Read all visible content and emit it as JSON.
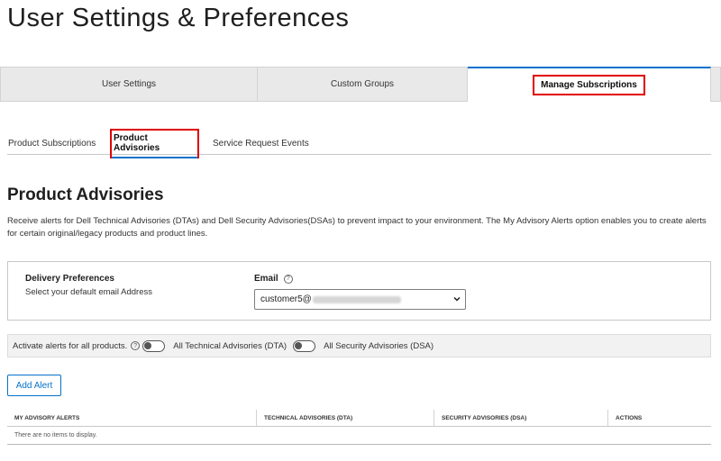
{
  "page_title": "User Settings & Preferences",
  "main_tabs": [
    {
      "label": "User Settings"
    },
    {
      "label": "Custom Groups"
    },
    {
      "label": "Manage Subscriptions"
    }
  ],
  "sub_tabs": [
    {
      "label": "Product Subscriptions"
    },
    {
      "label": "Product Advisories"
    },
    {
      "label": "Service Request Events"
    }
  ],
  "section": {
    "heading": "Product Advisories",
    "description": "Receive alerts for Dell Technical Advisories (DTAs) and Dell Security Advisories(DSAs) to prevent impact to your environment. The My Advisory Alerts option enables you to create alerts for certain original/legacy products and product lines."
  },
  "delivery": {
    "title": "Delivery Preferences",
    "subtitle": "Select your default email Address",
    "email_label": "Email",
    "email_value": "customer5@"
  },
  "alerts_bar": {
    "activate_label": "Activate alerts for all products.",
    "dta_label": "All Technical Advisories (DTA)",
    "dsa_label": "All Security Advisories (DSA)"
  },
  "add_alert_label": "Add Alert",
  "table": {
    "columns": [
      "MY ADVISORY ALERTS",
      "TECHNICAL ADVISORIES (DTA)",
      "SECURITY ADVISORIES (DSA)",
      "ACTIONS"
    ],
    "empty_text": "There are no items to display."
  },
  "colors": {
    "accent": "#0672cb",
    "highlight": "#e00000"
  },
  "icons": {
    "help": "help-circle-icon",
    "select": "chevron-down-icon"
  }
}
